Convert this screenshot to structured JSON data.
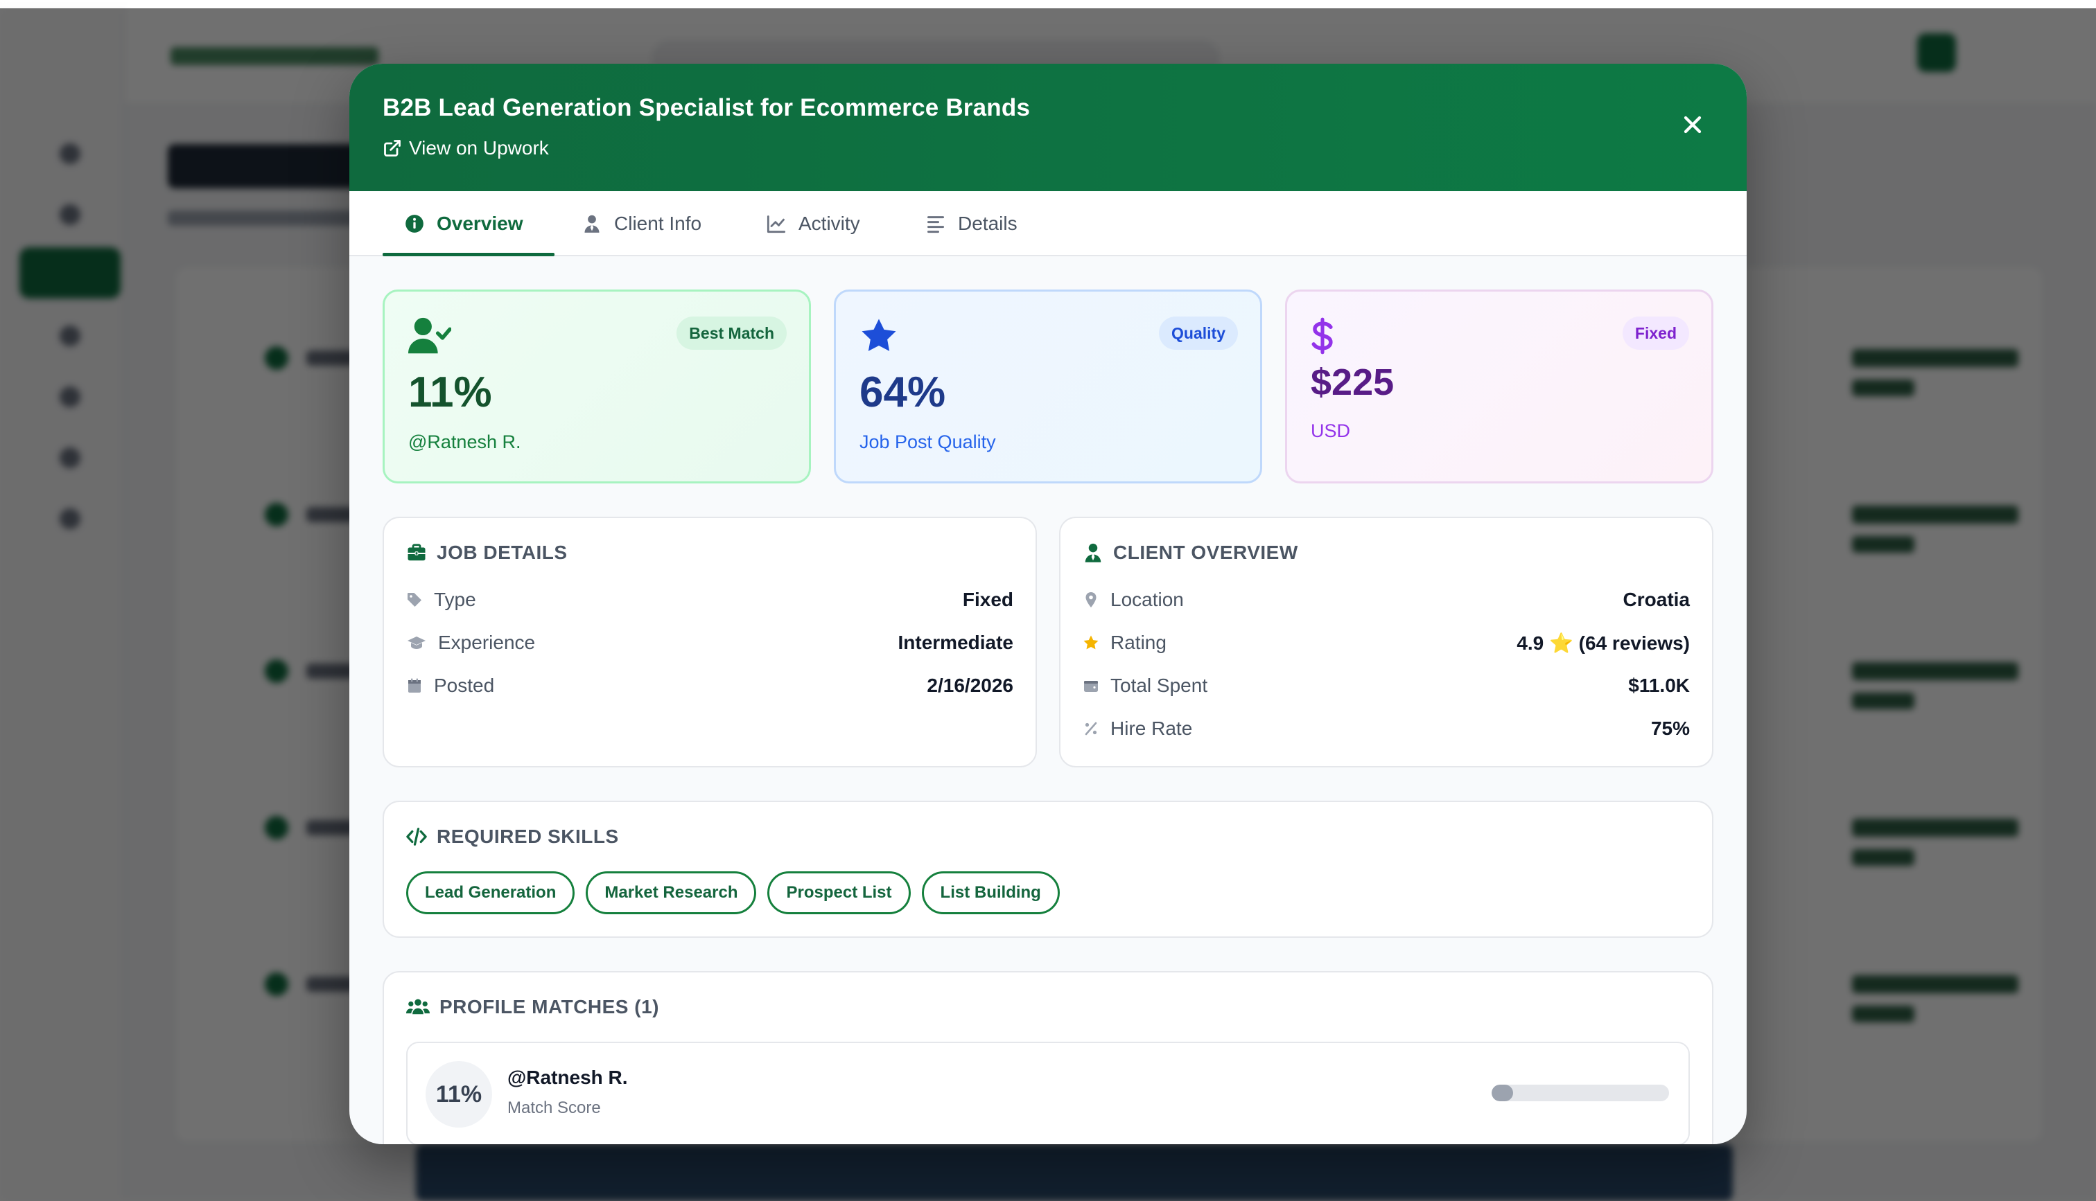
{
  "modal": {
    "title": "B2B Lead Generation Specialist for Ecommerce Brands",
    "view_link": "View on Upwork"
  },
  "tabs": [
    {
      "label": "Overview",
      "icon": "info-circle-icon",
      "active": true
    },
    {
      "label": "Client Info",
      "icon": "user-tie-icon",
      "active": false
    },
    {
      "label": "Activity",
      "icon": "line-chart-icon",
      "active": false
    },
    {
      "label": "Details",
      "icon": "align-left-icon",
      "active": false
    }
  ],
  "stats": {
    "match": {
      "badge": "Best Match",
      "value": "11%",
      "label": "@Ratnesh R.",
      "icon": "user-check-icon"
    },
    "quality": {
      "badge": "Quality",
      "value": "64%",
      "label": "Job Post Quality",
      "icon": "star-icon"
    },
    "budget": {
      "badge": "Fixed",
      "value": "$225",
      "label": "USD",
      "icon": "dollar-icon"
    }
  },
  "job_details": {
    "title": "JOB DETAILS",
    "rows": [
      {
        "key": "Type",
        "value": "Fixed",
        "icon": "tag-icon"
      },
      {
        "key": "Experience",
        "value": "Intermediate",
        "icon": "graduation-cap-icon"
      },
      {
        "key": "Posted",
        "value": "2/16/2026",
        "icon": "calendar-icon"
      }
    ]
  },
  "client_overview": {
    "title": "CLIENT OVERVIEW",
    "rows": [
      {
        "key": "Location",
        "value": "Croatia",
        "icon": "map-pin-icon"
      },
      {
        "key": "Rating",
        "value": "4.9 ⭐ (64 reviews)",
        "icon": "star-icon"
      },
      {
        "key": "Total Spent",
        "value": "$11.0K",
        "icon": "wallet-icon"
      },
      {
        "key": "Hire Rate",
        "value": "75%",
        "icon": "percent-icon"
      }
    ]
  },
  "skills": {
    "title": "REQUIRED SKILLS",
    "items": [
      "Lead Generation",
      "Market Research",
      "Prospect List",
      "List Building"
    ]
  },
  "profile_matches": {
    "title": "PROFILE MATCHES (1)",
    "items": [
      {
        "score": "11%",
        "name": "@Ratnesh R.",
        "subtitle": "Match Score",
        "progress": 0.11
      }
    ]
  },
  "colors": {
    "brand": "#0f6a3e",
    "green_card": "#effdf4",
    "blue_card": "#eff6ff",
    "purple_card": "#faf5ff"
  }
}
